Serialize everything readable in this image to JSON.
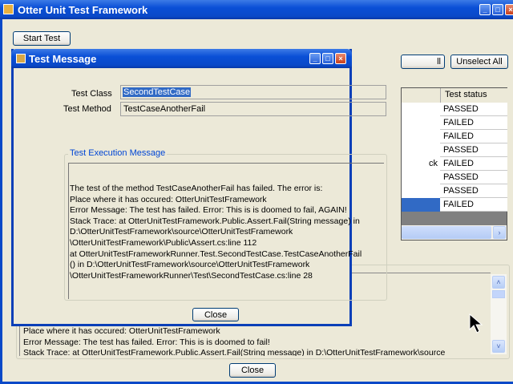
{
  "main_window": {
    "title": "Otter Unit Test Framework",
    "start_test": "Start Test",
    "select_all_partial": "ll",
    "unselect_all": "Unselect All",
    "close": "Close",
    "grid": {
      "header": "Test status",
      "partial_col_text": "ck",
      "statuses": [
        "PASSED",
        "FAILED",
        "FAILED",
        "PASSED",
        "FAILED",
        "PASSED",
        "PASSED",
        "FAILED"
      ]
    },
    "message_lines": [
      "Place where it has occured: OtterUnitTestFramework",
      "Error Message: The test has failed. Error: This is is doomed to fail!",
      "Stack Trace:    at OtterUnitTestFramework.Public.Assert.Fail(String message) in D:\\OtterUnitTestFramework\\source"
    ]
  },
  "dialog": {
    "title": "Test Message",
    "test_class_label": "Test Class",
    "test_class_value": "SecondTestCase",
    "test_method_label": "Test Method",
    "test_method_value": "TestCaseAnotherFail",
    "group_title": "Test Execution Message",
    "message_lines": [
      " The test of the method TestCaseAnotherFail has failed. The error is:",
      "Place where it has occured: OtterUnitTestFramework",
      " Error Message: The test has failed. Error: This is is doomed to fail, AGAIN!",
      " Stack Trace:    at OtterUnitTestFramework.Public.Assert.Fail(String message) in",
      "D:\\OtterUnitTestFramework\\source\\OtterUnitTestFramework",
      "\\OtterUnitTestFramework\\Public\\Assert.cs:line 112",
      "   at OtterUnitTestFrameworkRunner.Test.SecondTestCase.TestCaseAnotherFail",
      "() in D:\\OtterUnitTestFramework\\source\\OtterUnitTestFramework",
      "\\OtterUnitTestFrameworkRunner\\Test\\SecondTestCase.cs:line 28"
    ],
    "close": "Close"
  },
  "colors": {
    "title_blue": "#0a4fd6",
    "selection": "#316ac5",
    "group_title": "#0046d5"
  }
}
